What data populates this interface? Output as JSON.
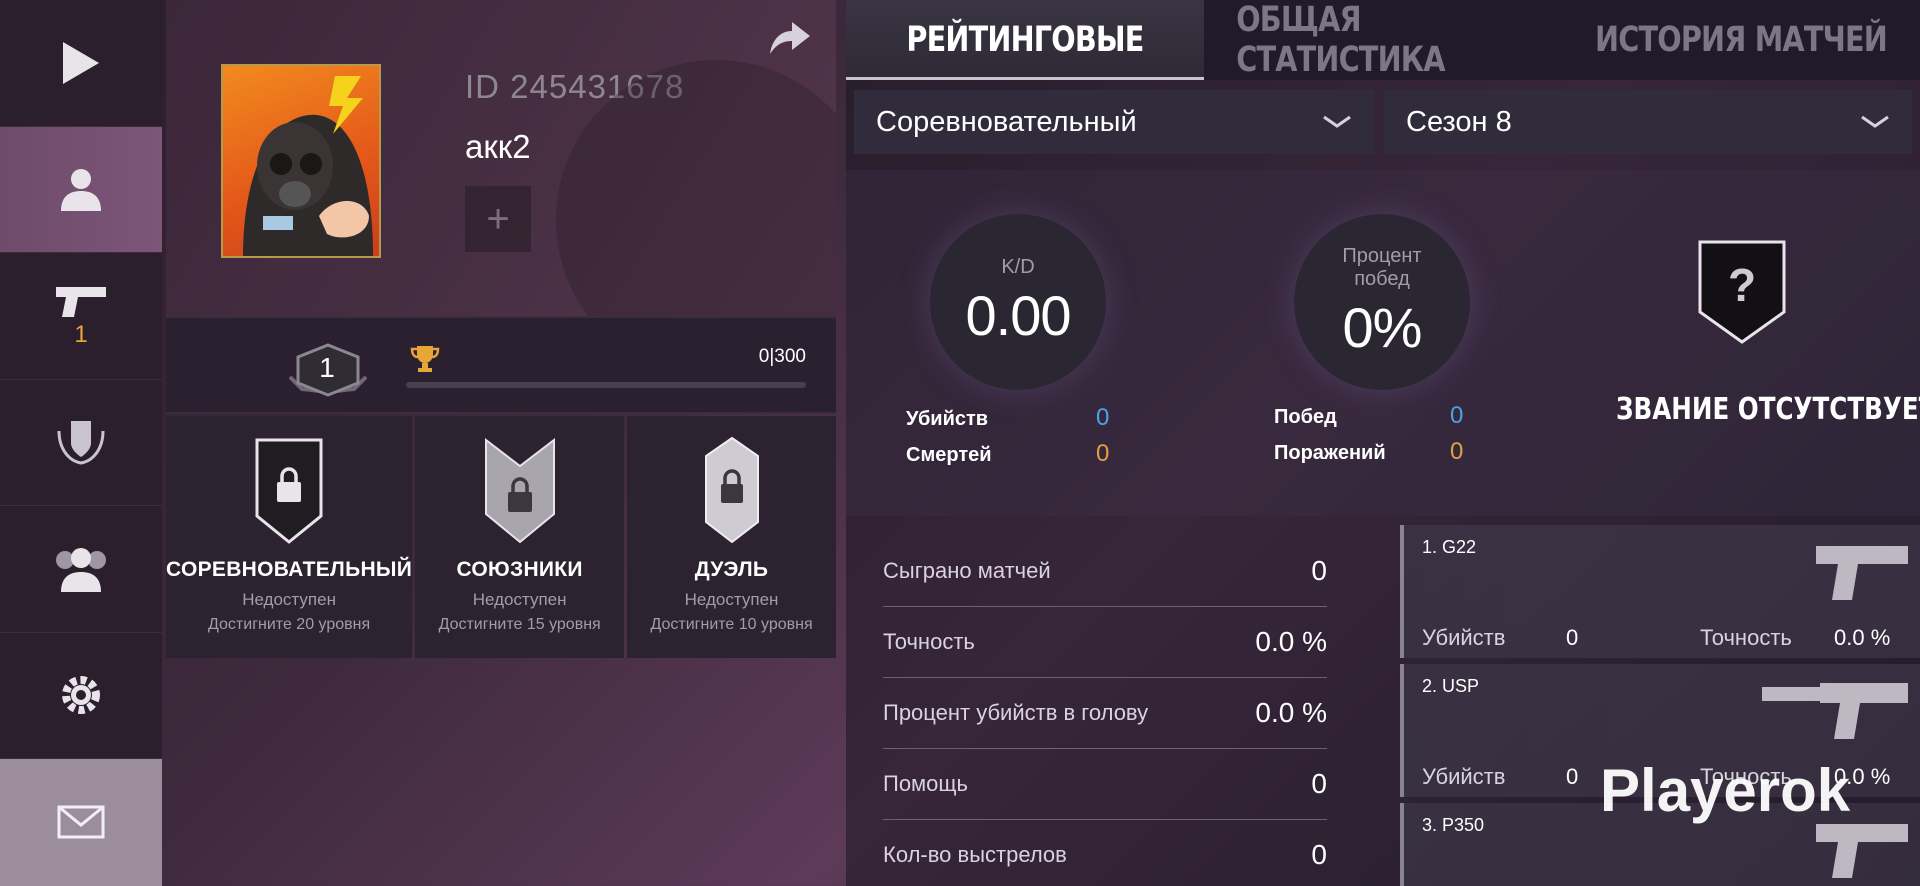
{
  "nav": {
    "weapons_badge": "1"
  },
  "profile": {
    "id_text": "ID 245431678",
    "name": "акк2",
    "add_symbol": "+"
  },
  "level": {
    "number": "1",
    "xp_text": "0|300",
    "xp_progress": 0
  },
  "modes": [
    {
      "title": "СОРЕВНОВАТЕЛЬНЫЙ",
      "status": "Недоступен",
      "requirement": "Достигните 20 уровня"
    },
    {
      "title": "СОЮЗНИКИ",
      "status": "Недоступен",
      "requirement": "Достигните 15 уровня"
    },
    {
      "title": "ДУЭЛЬ",
      "status": "Недоступен",
      "requirement": "Достигните 10 уровня"
    }
  ],
  "tabs": [
    {
      "label": "РЕЙТИНГОВЫЕ",
      "active": true
    },
    {
      "label": "ОБЩАЯ СТАТИСТИКА",
      "active": false
    },
    {
      "label": "ИСТОРИЯ МАТЧЕЙ",
      "active": false
    }
  ],
  "filters": {
    "mode": "Соревновательный",
    "season": "Сезон 8"
  },
  "summary": {
    "kd_label": "K/D",
    "kd_value": "0.00",
    "winrate_label_1": "Процент",
    "winrate_label_2": "побед",
    "winrate_value": "0%",
    "kills_label": "Убийств",
    "kills_value": "0",
    "deaths_label": "Смертей",
    "deaths_value": "0",
    "wins_label": "Побед",
    "wins_value": "0",
    "losses_label": "Поражений",
    "losses_value": "0",
    "rank_icon": "?",
    "rank_label": "ЗВАНИЕ ОТСУТСТВУЕТ"
  },
  "details": [
    {
      "label": "Сыграно матчей",
      "value": "0"
    },
    {
      "label": "Точность",
      "value": "0.0 %"
    },
    {
      "label": "Процент убийств в голову",
      "value": "0.0 %"
    },
    {
      "label": "Помощь",
      "value": "0"
    },
    {
      "label": "Кол-во выстрелов",
      "value": "0"
    }
  ],
  "weapons": [
    {
      "name": "1. G22",
      "kills_label": "Убийств",
      "kills": "0",
      "acc_label": "Точность",
      "acc": "0.0 %"
    },
    {
      "name": "2. USP",
      "kills_label": "Убийств",
      "kills": "0",
      "acc_label": "Точность",
      "acc": "0.0 %"
    },
    {
      "name": "3. P350",
      "kills_label": "",
      "kills": "",
      "acc_label": "",
      "acc": ""
    }
  ],
  "watermark": "Playerok",
  "colors": {
    "accent_orange": "#e7a737",
    "stat_blue": "#4aa3e8",
    "stat_orange": "#e3a043"
  }
}
